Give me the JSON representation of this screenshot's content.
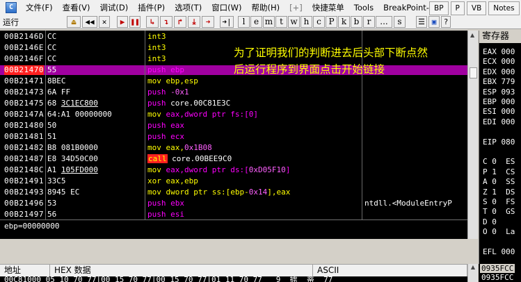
{
  "menu": {
    "app_icon": "C",
    "items": [
      "文件(F)",
      "查看(V)",
      "调试(D)",
      "插件(P)",
      "选项(T)",
      "窗口(W)",
      "帮助(H)",
      "[+]",
      "快捷菜单",
      "Tools",
      "BreakPoint->"
    ],
    "right_tabs": [
      "BP",
      "P",
      "VB",
      "Notes"
    ]
  },
  "toolbar": {
    "status": "运行",
    "buttons": [
      "⏏",
      "◀◀",
      "✕",
      "▶",
      "❚❚",
      "↳",
      "↴",
      "↱",
      "⤓",
      "➜",
      "➜|"
    ],
    "letters": [
      "l",
      "e",
      "m",
      "t",
      "w",
      "h",
      "c",
      "P",
      "k",
      "b",
      "r",
      "...",
      "s"
    ],
    "right_icons": [
      "☰",
      "▣",
      "?"
    ]
  },
  "cpu": {
    "rows": [
      {
        "addr": "00B2146D",
        "hex": "CC",
        "hex_u": "",
        "hex2": "",
        "mn": "int3",
        "mnc": "int",
        "ops": [],
        "cmt": ""
      },
      {
        "addr": "00B2146E",
        "hex": "CC",
        "hex_u": "",
        "hex2": "",
        "mn": "int3",
        "mnc": "int",
        "ops": [],
        "cmt": ""
      },
      {
        "addr": "00B2146F",
        "hex": "CC",
        "hex_u": "",
        "hex2": "",
        "mn": "int3",
        "mnc": "int",
        "ops": [],
        "cmt": ""
      },
      {
        "addr": "00B21470",
        "hex": "55",
        "hex_u": "",
        "hex2": "",
        "mn": "push",
        "mnc": "push",
        "ops": [
          {
            "t": " ebp",
            "c": "m-push"
          }
        ],
        "cmt": "",
        "highlight": true
      },
      {
        "addr": "00B21471",
        "hex": "8BEC",
        "hex_u": "",
        "hex2": "",
        "mn": "mov",
        "mnc": "mov",
        "ops": [
          {
            "t": " ebp,esp",
            "c": "m-mov"
          }
        ],
        "cmt": ""
      },
      {
        "addr": "00B21473",
        "hex": "6A FF",
        "hex_u": "",
        "hex2": "",
        "mn": "push",
        "mnc": "push",
        "ops": [
          {
            "t": " -0x1",
            "c": "op-num"
          }
        ],
        "cmt": ""
      },
      {
        "addr": "00B21475",
        "hex": "68 ",
        "hex_u": "3C1EC800",
        "hex2": "",
        "mn": "push",
        "mnc": "push",
        "ops": [
          {
            "t": " core.00C81E3C",
            "c": "op-str"
          }
        ],
        "cmt": ""
      },
      {
        "addr": "00B2147A",
        "hex": "64:A1 00000000",
        "hex_u": "",
        "hex2": "",
        "mn": "mov",
        "mnc": "mov",
        "ops": [
          {
            "t": " eax,dword ptr fs:[0]",
            "c": "m-push"
          }
        ],
        "cmt": ""
      },
      {
        "addr": "00B21480",
        "hex": "50",
        "hex_u": "",
        "hex2": "",
        "mn": "push",
        "mnc": "push",
        "ops": [
          {
            "t": " eax",
            "c": "m-push"
          }
        ],
        "cmt": ""
      },
      {
        "addr": "00B21481",
        "hex": "51",
        "hex_u": "",
        "hex2": "",
        "mn": "push",
        "mnc": "push",
        "ops": [
          {
            "t": " ecx",
            "c": "m-push"
          }
        ],
        "cmt": ""
      },
      {
        "addr": "00B21482",
        "hex": "B8 081B0000",
        "hex_u": "",
        "hex2": "",
        "mn": "mov",
        "mnc": "mov",
        "ops": [
          {
            "t": " eax,",
            "c": "m-mov"
          },
          {
            "t": "0x1B08",
            "c": "op-num"
          }
        ],
        "cmt": ""
      },
      {
        "addr": "00B21487",
        "hex": "E8 34D50C00",
        "hex_u": "",
        "hex2": "",
        "mn": "call",
        "mnc": "call",
        "ops": [
          {
            "t": " core.00BEE9C0",
            "c": "op-str"
          }
        ],
        "cmt": ""
      },
      {
        "addr": "00B2148C",
        "hex": "A1 ",
        "hex_u": "105FD000",
        "hex2": "",
        "mn": "mov",
        "mnc": "mov",
        "ops": [
          {
            "t": " eax,dword ptr ds:[",
            "c": "m-push"
          },
          {
            "t": "0xD05F10",
            "c": "op-num"
          },
          {
            "t": "]",
            "c": "m-push"
          }
        ],
        "cmt": ""
      },
      {
        "addr": "00B21491",
        "hex": "33C5",
        "hex_u": "",
        "hex2": "",
        "mn": "xor",
        "mnc": "xor",
        "ops": [
          {
            "t": " eax,ebp",
            "c": "m-mov"
          }
        ],
        "cmt": ""
      },
      {
        "addr": "00B21493",
        "hex": "8945 EC",
        "hex_u": "",
        "hex2": "",
        "mn": "mov",
        "mnc": "mov",
        "ops": [
          {
            "t": " dword ptr ss:[ebp-",
            "c": "m-mov"
          },
          {
            "t": "0x14",
            "c": "op-num"
          },
          {
            "t": "],eax",
            "c": "m-mov"
          }
        ],
        "cmt": ""
      },
      {
        "addr": "00B21496",
        "hex": "53",
        "hex_u": "",
        "hex2": "",
        "mn": "push",
        "mnc": "push",
        "ops": [
          {
            "t": " ebx",
            "c": "m-push"
          }
        ],
        "cmt": "ntdll.<ModuleEntryP"
      },
      {
        "addr": "00B21497",
        "hex": "56",
        "hex_u": "",
        "hex2": "",
        "mn": "push",
        "mnc": "push",
        "ops": [
          {
            "t": " esi",
            "c": "m-push"
          }
        ],
        "cmt": ""
      }
    ],
    "note": "为了证明我们的判断进去后头部下断点然后运行程序到界面点击开始链接",
    "info": "ebp=00000000"
  },
  "registers": {
    "title": "寄存器",
    "lines": [
      "EAX 000",
      "ECX 000",
      "EDX 000",
      "EBX 779",
      "ESP 093",
      "EBP 000",
      "ESI 000",
      "EDI 000",
      "",
      "EIP 080",
      "",
      "C 0  ES",
      "P 1  CS",
      "A 0  SS",
      "Z 1  DS",
      "S 0  FS",
      "T 0  GS",
      "D 0",
      "O 0  La",
      "",
      "EFL 000"
    ]
  },
  "dump": {
    "col_addr": "地址",
    "col_hex": "HEX 数据",
    "col_ascii": "ASCII",
    "row": "00C81000 05 10 70 77|00 15 70 77|00 15 70 77|01 11 70 77   9  掳  蒂  77"
  },
  "stack": {
    "line1": "0935FCC",
    "line2": "0935FCC"
  }
}
